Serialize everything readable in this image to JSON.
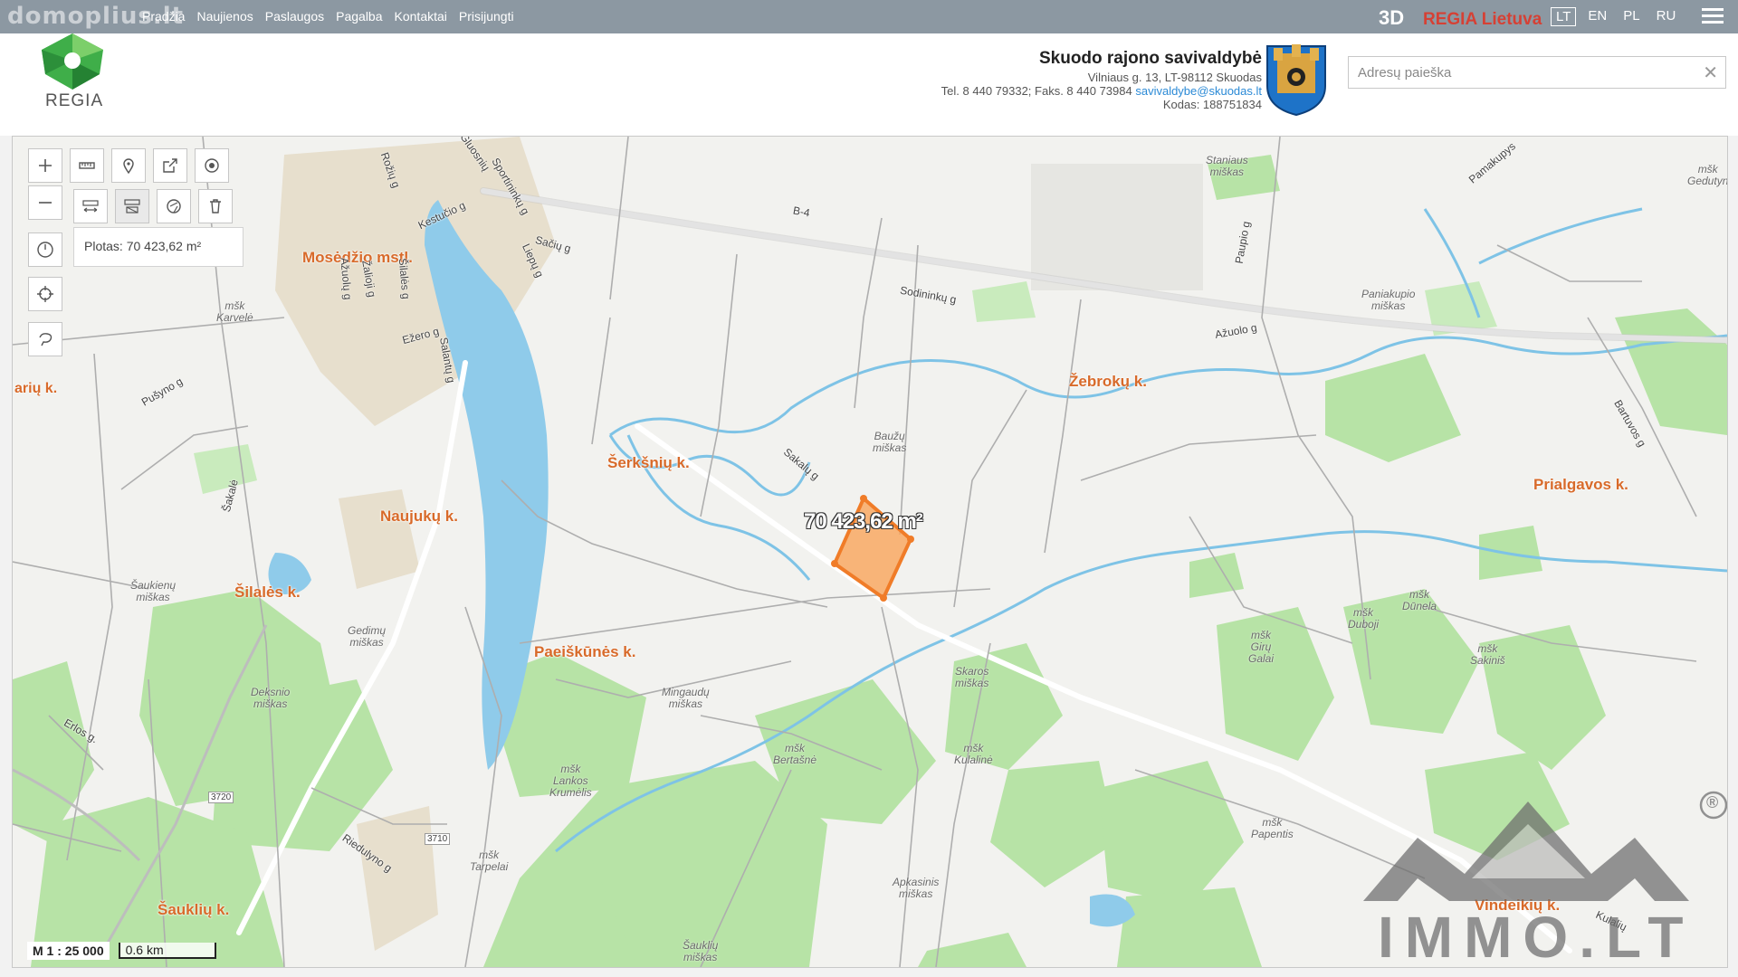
{
  "topbar": {
    "brand": "domoplius.lt",
    "nav": [
      "Pradžia",
      "Naujienos",
      "Paslaugos",
      "Pagalba",
      "Kontaktai",
      "Prisijungti"
    ],
    "mode": "3D",
    "regia": "REGIA Lietuva",
    "languages": [
      "LT",
      "EN",
      "PL",
      "RU"
    ],
    "active_language": "LT"
  },
  "header": {
    "logo_text": "REGIA",
    "municipality": "Skuodo rajono savivaldybė",
    "address": "Vilniaus g. 13, LT-98112 Skuodas",
    "phone_fax": "Tel. 8 440 79332; Faks. 8 440 73984",
    "email": "savivaldybe@skuodas.lt",
    "code": "Kodas: 188751834",
    "search_placeholder": "Adresų paieška",
    "search_clear": "✕"
  },
  "map": {
    "measure_result": "Plotas: 70 423,62 m²",
    "area_label": "70 423,62 m²",
    "scale": "M 1 : 25 000",
    "scale_bar": "0.6 km",
    "tools_row1": [
      "ruler-icon",
      "pin-icon",
      "export-icon",
      "target-icon"
    ],
    "tools_row2": [
      "measure-distance-icon",
      "measure-area-icon",
      "clear-measure-icon",
      "trash-icon"
    ],
    "places": {
      "mosedis": "Mosėdžio mstl.",
      "ariu": "arių k.",
      "zebroku": "Žebrokų k.",
      "serksniu": "Šerkšnių k.",
      "naujuku": "Naujukų k.",
      "prialgavos": "Prialgavos k.",
      "silales": "Šilalės k.",
      "paeiskunes": "Paeiškūnės k.",
      "sankliu": "Šauklių k.",
      "vindeikiu": "Vindeikių k."
    },
    "forests": {
      "staniaus": "Staniaus\nmiškas",
      "geduty": "mšk\nGedutyn",
      "paniakupio": "Paniakupio\nmiškas",
      "karvele": "mšk\nKarvelė",
      "bauzu": "Baužų\nmiškas",
      "saukienu": "Šaukienų\nmiškas",
      "gedimu": "Gedimų\nmiškas",
      "dunela": "mšk\nDūnela",
      "duboji": "mšk\nDuboji",
      "giru": "mšk\nGirų\nGalai",
      "sakiniai": "mšk\nSakiniš",
      "deksnio": "Deksnio\nmiškas",
      "skaros": "Skaros\nmiškas",
      "mingaudu": "Mingaudų\nmiškas",
      "bertasne": "mšk\nBertašnė",
      "kulaline": "mšk\nKulalinė",
      "lankos": "mšk\nLankos\nKrumėlis",
      "tarpelai": "mšk\nTarpelai",
      "papentis": "mšk\nPapentis",
      "apkasinis": "Apkasinis\nmiškas",
      "saukiu": "Šauklių\nmiškas"
    },
    "roads": {
      "kestucio": "Kestučio g",
      "saciu": "Sačių g",
      "b4": "B-4",
      "sodininku": "Sodininkų g",
      "paupio": "Paupio g",
      "azuolo": "Ažuolo g",
      "pamakupys": "Pamakupys",
      "ezero": "Ežero g",
      "zalioji": "Žalioji g",
      "azuolu": "Ažuolų g",
      "silales_g": "Šilalės g",
      "salantu": "Salantų g",
      "lieplu": "Liepų g",
      "pusyno": "Pušyno g",
      "sakalu": "Sakalų g",
      "bartuvos": "Bartuvos g",
      "sakale": "Šakalė",
      "erlos": "Erlos g.",
      "r3720": "3720",
      "r3710": "3710",
      "riedulyno": "Riedulyno g",
      "kulalu": "Kulalių",
      "sportininku": "Sportininkų g",
      "rozu": "Rožių g",
      "gluosniu": "Gluosnių"
    }
  },
  "watermark": {
    "text": "IMMO.LT",
    "registered": "®"
  },
  "colors": {
    "topbar": "#8c98a2",
    "regia_red": "#d64034",
    "forest": "#b5e2a5",
    "water": "#8fcbea",
    "parcel": "#f07c28",
    "town_label": "#d86a2a"
  }
}
